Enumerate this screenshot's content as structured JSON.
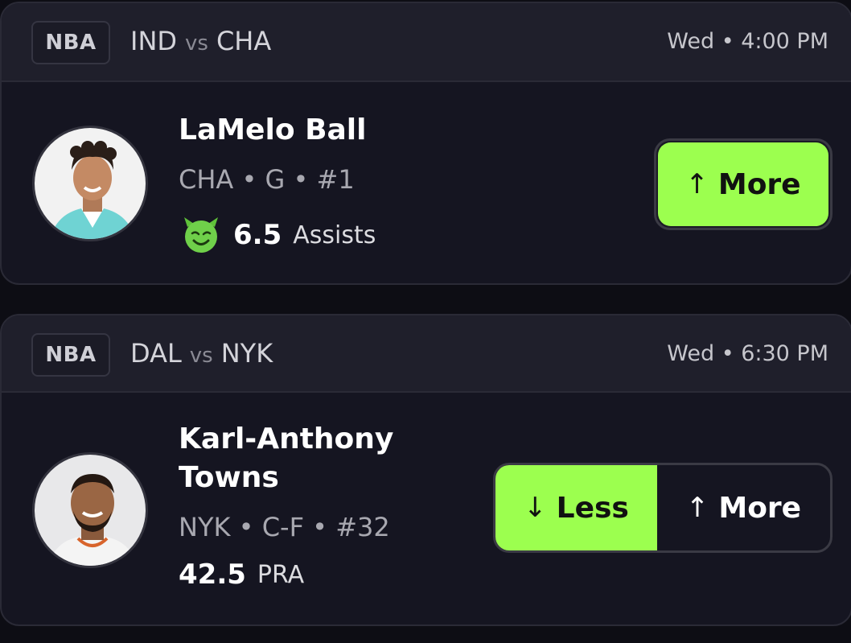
{
  "cards": [
    {
      "league": "NBA",
      "team_a": "IND",
      "vs": "vs",
      "team_b": "CHA",
      "time": "Wed • 4:00 PM",
      "player_name": "LaMelo Ball",
      "player_meta": "CHA • G • #1",
      "line_value": "6.5",
      "stat": "Assists",
      "more_label": "More",
      "more_arrow": "↑",
      "avatar_jersey_color": "#6fd3d3"
    },
    {
      "league": "NBA",
      "team_a": "DAL",
      "vs": "vs",
      "team_b": "NYK",
      "time": "Wed • 6:30 PM",
      "player_name_line1": "Karl-Anthony",
      "player_name_line2": "Towns",
      "player_meta": "NYK • C-F • #32",
      "line_value": "42.5",
      "stat": "PRA",
      "less_label": "Less",
      "less_arrow": "↓",
      "more_label": "More",
      "more_arrow": "↑"
    }
  ],
  "colors": {
    "accent": "#9cff4f",
    "card_bg": "#151521",
    "header_bg": "#1f1f2b"
  },
  "icons": {
    "demon": "demon-icon"
  }
}
